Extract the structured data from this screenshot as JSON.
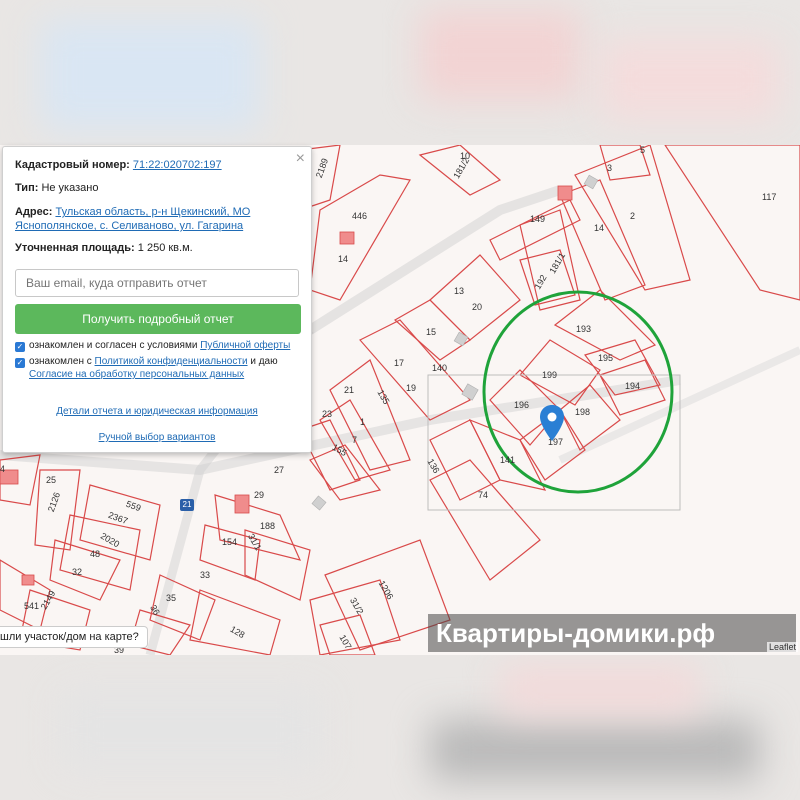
{
  "popup": {
    "cadastral_label": "Кадастровый номер:",
    "cadastral_value": "71:22:020702:197",
    "type_label": "Тип:",
    "type_value": "Не указано",
    "address_label": "Адрес:",
    "address_line1": "Тульская область, р-н Щекинский, МО",
    "address_line2": "Яснополянское, с. Селиваново, ул. Гагарина",
    "area_label": "Уточненная площадь:",
    "area_value": "1 250 кв.м.",
    "email_placeholder": "Ваш email, куда отправить отчет",
    "report_button": "Получить подробный отчет",
    "check1_text": "ознакомлен и согласен с условиями ",
    "check1_link": "Публичной оферты",
    "check2_text": "ознакомлен с ",
    "check2_link": "Политикой конфиденциальности",
    "check2_tail": " и даю",
    "check2_link2": "Согласие на обработку персональных данных",
    "details_link": "Детали отчета и юридическая информация",
    "manual_link": "Ручной выбор вариантов",
    "close": "×"
  },
  "map": {
    "parcel_labels": [
      "117",
      "2",
      "14",
      "3",
      "5",
      "149",
      "181/1",
      "192",
      "446",
      "14",
      "2189",
      "181/2",
      "20",
      "13",
      "15",
      "140",
      "193",
      "195",
      "194",
      "199",
      "196",
      "198",
      "197",
      "141",
      "17",
      "21",
      "19",
      "135",
      "23",
      "1",
      "7",
      "155",
      "136",
      "74",
      "27",
      "25",
      "29",
      "2126",
      "559",
      "2367",
      "188",
      "31/1",
      "154",
      "2020",
      "48",
      "32",
      "33",
      "2149",
      "35",
      "36",
      "128",
      "541",
      "1206",
      "31/2",
      "107",
      "39",
      "553",
      "4",
      "10"
    ],
    "marker_label": "197",
    "route_sign": "21"
  },
  "footer": {
    "question": "шли участок/дом на карте?",
    "leaflet": "Leaflet"
  },
  "watermark": "Квартиры-домики.рф",
  "colors": {
    "parcel_line": "#d94a4a",
    "highlight_circle": "#1fa33a",
    "marker": "#2a7fd4",
    "button": "#5cb85c"
  }
}
